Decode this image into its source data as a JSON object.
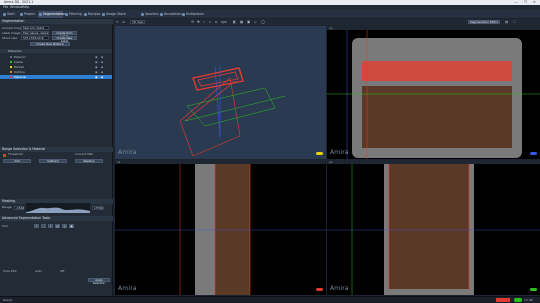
{
  "window": {
    "title": "Amira 3D - 2021.1",
    "minimize": "—",
    "maximize": "☐",
    "close": "✕"
  },
  "menu": [
    "File",
    "Window",
    "Help"
  ],
  "tabs": [
    {
      "label": "Start",
      "active": false
    },
    {
      "label": "Project",
      "active": false
    },
    {
      "label": "Segmentation",
      "active": true
    },
    {
      "label": "Filtering",
      "active": false
    },
    {
      "label": "Recipes",
      "active": false
    },
    {
      "label": "Image Stack Registration",
      "active": false
    },
    {
      "label": "Xporters",
      "active": false
    },
    {
      "label": "Annotation",
      "active": false
    },
    {
      "label": "Multiplanar",
      "active": false
    }
  ],
  "left_panel": {
    "header": "Segmentation",
    "labels": {
      "current_image": "Current image",
      "current_image_value": "fiber.am::data1",
      "label_image": "Label image",
      "label_image_value": "fiber.labels::data1",
      "stack": "Stack size",
      "stack_value": "507×393×616",
      "sel_img_a": "Create from Labels",
      "sel_img_b": "Create New Label",
      "create_btn": "Create New Material"
    },
    "materials_header": "Materials",
    "materials": [
      {
        "name": "Exterior",
        "selected": false
      },
      {
        "name": "Inside",
        "selected": false
      },
      {
        "name": "Pocket",
        "selected": false
      },
      {
        "name": "Outline",
        "selected": false
      },
      {
        "name": "Material",
        "selected": true
      }
    ],
    "selection": {
      "header": "Range Selection & Material",
      "label_a": "Threshold",
      "label_b": "Current Mat",
      "btn1": "Add",
      "btn2": "Subtract",
      "btn3": "Replace"
    },
    "masking": {
      "header": "Masking",
      "range_label": "Range",
      "min": "-6340",
      "max": "13766"
    },
    "tools": {
      "header": "Advanced Segmentation Tools",
      "label": "Tool",
      "footer_a": "Slice Plot",
      "footer_b": "Auto",
      "footer_c": "Off",
      "footer_btn": "Apply Selection"
    }
  },
  "toolbar": {
    "view_label": "3D View",
    "layout_label": "Layout",
    "orientation": "xyz",
    "right_btn": "Segmentation Editor"
  },
  "viewports": {
    "tl": {
      "badge": "",
      "amira": "Amira"
    },
    "tr": {
      "badge": "xy",
      "amira": "Amira"
    },
    "bl": {
      "badge": "xz",
      "amira": "Amira"
    },
    "br": {
      "badge": "yz",
      "amira": "Amira"
    }
  },
  "status": {
    "left": "Ready",
    "right_a": "",
    "tray": "13:48"
  },
  "colors": {
    "accent": "#2f7fd4",
    "red": "#e53a2f",
    "green": "#2bc21d",
    "yellow": "#e8d200"
  }
}
